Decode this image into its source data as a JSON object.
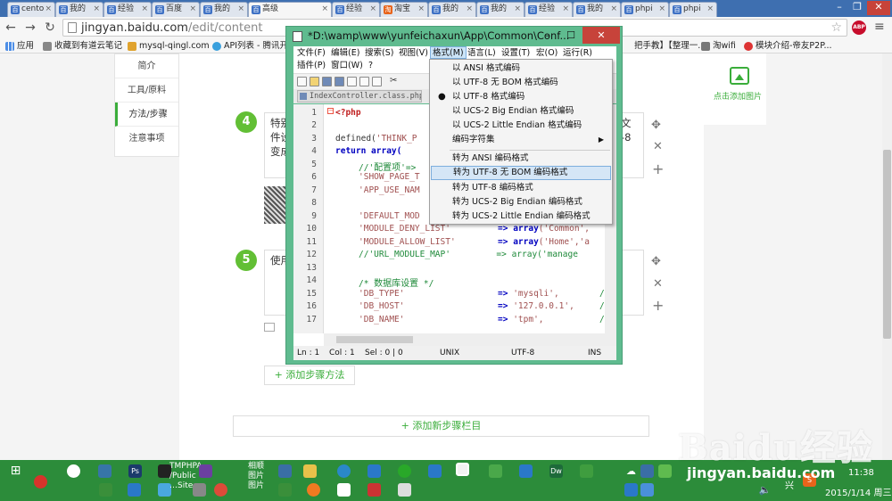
{
  "browser": {
    "tabs": [
      {
        "label": "cento",
        "active": false
      },
      {
        "label": "我的",
        "active": false
      },
      {
        "label": "经验",
        "active": false
      },
      {
        "label": "百度",
        "active": false
      },
      {
        "label": "我的",
        "active": false
      },
      {
        "label": "高级",
        "active": true
      },
      {
        "label": "经验",
        "active": false
      },
      {
        "label": "淘宝",
        "active": false
      },
      {
        "label": "我的",
        "active": false
      },
      {
        "label": "我的",
        "active": false
      },
      {
        "label": "经验",
        "active": false
      },
      {
        "label": "我的",
        "active": false
      },
      {
        "label": "phpi",
        "active": false
      },
      {
        "label": "phpi",
        "active": false
      }
    ],
    "url_host": "jingyan.baidu.com",
    "url_path": "/edit/content",
    "bookmarks": [
      "应用",
      "收藏到有道云笔记",
      "mysql-qingl.com",
      "API列表 - 腾讯开放",
      "把手教】【整理一...",
      "淘wifi",
      "模块介绍-帝友P2P..."
    ]
  },
  "page": {
    "sidebar": [
      "简介",
      "工具/原料",
      "方法/步骤",
      "注意事项"
    ],
    "sidebar_active_index": 2,
    "add_picture": "点击添加图片",
    "step4": {
      "num": "4",
      "line1": "特别",
      "line1_end": "文",
      "line2": "件设",
      "line2_end": "-8",
      "line3": "变成"
    },
    "step5": {
      "num": "5",
      "text": "使用"
    },
    "add_method": "+ 添加步骤方法",
    "add_column": "+ 添加新步骤栏目"
  },
  "editor": {
    "title": "*D:\\wamp\\www\\yunfeichaxun\\App\\Common\\Conf...",
    "menus": [
      "文件(F)",
      "编辑(E)",
      "搜索(S)",
      "视图(V)",
      "格式(M)",
      "语言(L)",
      "设置(T)",
      "宏(O)",
      "运行(R)",
      "插件(P)",
      "窗口(W)",
      "?"
    ],
    "open_menu_index": 4,
    "tab_label": "IndexController.class.php",
    "line_numbers": [
      "1",
      "2",
      "3",
      "4",
      "5",
      "6",
      "7",
      "8",
      "9",
      "10",
      "11",
      "12",
      "13",
      "14",
      "15",
      "16",
      "17"
    ],
    "status": {
      "ln": "Ln : 1",
      "col": "Col : 1",
      "sel": "Sel : 0 | 0",
      "eol": "UNIX",
      "enc": "UTF-8",
      "mode": "INS"
    },
    "format_menu": [
      {
        "label": "以 ANSI 格式编码",
        "checked": false
      },
      {
        "label": "以 UTF-8 无 BOM 格式编码",
        "checked": false
      },
      {
        "label": "以 UTF-8 格式编码",
        "checked": true
      },
      {
        "label": "以 UCS-2 Big Endian 格式编码",
        "checked": false
      },
      {
        "label": "以 UCS-2 Little Endian 格式编码",
        "checked": false
      },
      {
        "label": "编码字符集",
        "checked": false,
        "submenu": true
      },
      {
        "label": "转为 ANSI 编码格式",
        "checked": false
      },
      {
        "label": "转为 UTF-8 无 BOM 编码格式",
        "checked": false,
        "highlighted": true
      },
      {
        "label": "转为 UTF-8 编码格式",
        "checked": false
      },
      {
        "label": "转为 UCS-2 Big Endian 编码格式",
        "checked": false
      },
      {
        "label": "转为 UCS-2 Little Endian 编码格式",
        "checked": false
      }
    ]
  },
  "code_lines": {
    "l1": "<?php",
    "l3a": "defined(",
    "l3b": "'THINK_P",
    "l4": "return",
    "l4b": " array(",
    "l5a": "//'",
    "l5b": "配置项",
    "l5c": "'=>",
    "l6": "'SHOW_PAGE_T",
    "l7": "'APP_USE_NAM",
    "l9": "'DEFAULT_MOD",
    "l10a": "'MODULE_DENY_LIST'",
    "l10b": "=>",
    "l10c": "array",
    "l10d": "('Common',",
    "l11a": "'MODULE_ALLOW_LIST'",
    "l11b": "=>",
    "l11c": "array",
    "l11d": "('Home','a",
    "l12": "//'URL_MODULE_MAP'         => array('manage",
    "l14a": "/* ",
    "l14b": "数据库设置",
    "l14c": " */",
    "l15a": "'DB_TYPE'",
    "l15b": "=>",
    "l15c": "'mysqli',",
    "l15d": "/",
    "l16a": "'DB_HOST'",
    "l16b": "=>",
    "l16c": "'127.0.0.1',",
    "l16d": "/",
    "l17a": "'DB_NAME'",
    "l17b": "=>",
    "l17c": "'tpm',",
    "l17d": "/"
  },
  "taskbar": {
    "labels": [
      "TMPHPA",
      "/Public",
      "…Site",
      "相顺",
      "图片",
      "图片"
    ],
    "ime": "兴",
    "time": "11:38",
    "date": "2015/1/14 周三"
  },
  "watermark": {
    "brand": "Baidu经验",
    "url": "jingyan.baidu.com"
  }
}
